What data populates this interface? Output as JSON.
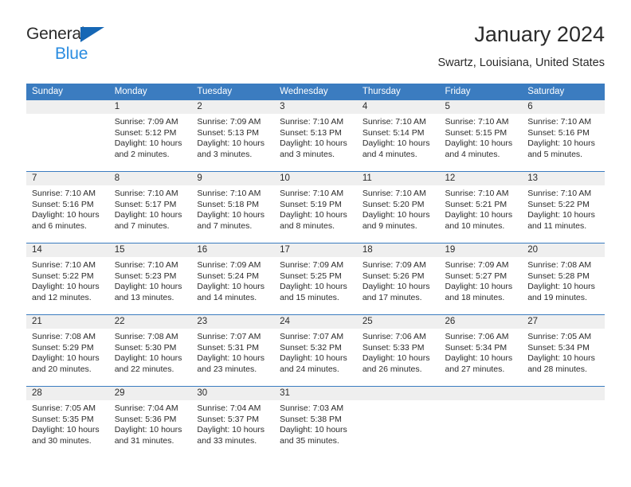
{
  "brand": {
    "name_part1": "General",
    "name_part2": "Blue",
    "accent_color": "#2a8ce0",
    "triangle_color": "#1667b5"
  },
  "header": {
    "title": "January 2024",
    "subtitle": "Swartz, Louisiana, United States"
  },
  "calendar": {
    "header_color": "#3b7cc0",
    "daynum_band_color": "#efefef",
    "weekday_headers": [
      "Sunday",
      "Monday",
      "Tuesday",
      "Wednesday",
      "Thursday",
      "Friday",
      "Saturday"
    ],
    "weeks": [
      [
        {
          "day": "",
          "empty": true,
          "sunrise": "",
          "sunset": "",
          "daylight_line1": "",
          "daylight_line2": ""
        },
        {
          "day": "1",
          "empty": false,
          "sunrise": "Sunrise: 7:09 AM",
          "sunset": "Sunset: 5:12 PM",
          "daylight_line1": "Daylight: 10 hours",
          "daylight_line2": "and 2 minutes."
        },
        {
          "day": "2",
          "empty": false,
          "sunrise": "Sunrise: 7:09 AM",
          "sunset": "Sunset: 5:13 PM",
          "daylight_line1": "Daylight: 10 hours",
          "daylight_line2": "and 3 minutes."
        },
        {
          "day": "3",
          "empty": false,
          "sunrise": "Sunrise: 7:10 AM",
          "sunset": "Sunset: 5:13 PM",
          "daylight_line1": "Daylight: 10 hours",
          "daylight_line2": "and 3 minutes."
        },
        {
          "day": "4",
          "empty": false,
          "sunrise": "Sunrise: 7:10 AM",
          "sunset": "Sunset: 5:14 PM",
          "daylight_line1": "Daylight: 10 hours",
          "daylight_line2": "and 4 minutes."
        },
        {
          "day": "5",
          "empty": false,
          "sunrise": "Sunrise: 7:10 AM",
          "sunset": "Sunset: 5:15 PM",
          "daylight_line1": "Daylight: 10 hours",
          "daylight_line2": "and 4 minutes."
        },
        {
          "day": "6",
          "empty": false,
          "sunrise": "Sunrise: 7:10 AM",
          "sunset": "Sunset: 5:16 PM",
          "daylight_line1": "Daylight: 10 hours",
          "daylight_line2": "and 5 minutes."
        }
      ],
      [
        {
          "day": "7",
          "empty": false,
          "sunrise": "Sunrise: 7:10 AM",
          "sunset": "Sunset: 5:16 PM",
          "daylight_line1": "Daylight: 10 hours",
          "daylight_line2": "and 6 minutes."
        },
        {
          "day": "8",
          "empty": false,
          "sunrise": "Sunrise: 7:10 AM",
          "sunset": "Sunset: 5:17 PM",
          "daylight_line1": "Daylight: 10 hours",
          "daylight_line2": "and 7 minutes."
        },
        {
          "day": "9",
          "empty": false,
          "sunrise": "Sunrise: 7:10 AM",
          "sunset": "Sunset: 5:18 PM",
          "daylight_line1": "Daylight: 10 hours",
          "daylight_line2": "and 7 minutes."
        },
        {
          "day": "10",
          "empty": false,
          "sunrise": "Sunrise: 7:10 AM",
          "sunset": "Sunset: 5:19 PM",
          "daylight_line1": "Daylight: 10 hours",
          "daylight_line2": "and 8 minutes."
        },
        {
          "day": "11",
          "empty": false,
          "sunrise": "Sunrise: 7:10 AM",
          "sunset": "Sunset: 5:20 PM",
          "daylight_line1": "Daylight: 10 hours",
          "daylight_line2": "and 9 minutes."
        },
        {
          "day": "12",
          "empty": false,
          "sunrise": "Sunrise: 7:10 AM",
          "sunset": "Sunset: 5:21 PM",
          "daylight_line1": "Daylight: 10 hours",
          "daylight_line2": "and 10 minutes."
        },
        {
          "day": "13",
          "empty": false,
          "sunrise": "Sunrise: 7:10 AM",
          "sunset": "Sunset: 5:22 PM",
          "daylight_line1": "Daylight: 10 hours",
          "daylight_line2": "and 11 minutes."
        }
      ],
      [
        {
          "day": "14",
          "empty": false,
          "sunrise": "Sunrise: 7:10 AM",
          "sunset": "Sunset: 5:22 PM",
          "daylight_line1": "Daylight: 10 hours",
          "daylight_line2": "and 12 minutes."
        },
        {
          "day": "15",
          "empty": false,
          "sunrise": "Sunrise: 7:10 AM",
          "sunset": "Sunset: 5:23 PM",
          "daylight_line1": "Daylight: 10 hours",
          "daylight_line2": "and 13 minutes."
        },
        {
          "day": "16",
          "empty": false,
          "sunrise": "Sunrise: 7:09 AM",
          "sunset": "Sunset: 5:24 PM",
          "daylight_line1": "Daylight: 10 hours",
          "daylight_line2": "and 14 minutes."
        },
        {
          "day": "17",
          "empty": false,
          "sunrise": "Sunrise: 7:09 AM",
          "sunset": "Sunset: 5:25 PM",
          "daylight_line1": "Daylight: 10 hours",
          "daylight_line2": "and 15 minutes."
        },
        {
          "day": "18",
          "empty": false,
          "sunrise": "Sunrise: 7:09 AM",
          "sunset": "Sunset: 5:26 PM",
          "daylight_line1": "Daylight: 10 hours",
          "daylight_line2": "and 17 minutes."
        },
        {
          "day": "19",
          "empty": false,
          "sunrise": "Sunrise: 7:09 AM",
          "sunset": "Sunset: 5:27 PM",
          "daylight_line1": "Daylight: 10 hours",
          "daylight_line2": "and 18 minutes."
        },
        {
          "day": "20",
          "empty": false,
          "sunrise": "Sunrise: 7:08 AM",
          "sunset": "Sunset: 5:28 PM",
          "daylight_line1": "Daylight: 10 hours",
          "daylight_line2": "and 19 minutes."
        }
      ],
      [
        {
          "day": "21",
          "empty": false,
          "sunrise": "Sunrise: 7:08 AM",
          "sunset": "Sunset: 5:29 PM",
          "daylight_line1": "Daylight: 10 hours",
          "daylight_line2": "and 20 minutes."
        },
        {
          "day": "22",
          "empty": false,
          "sunrise": "Sunrise: 7:08 AM",
          "sunset": "Sunset: 5:30 PM",
          "daylight_line1": "Daylight: 10 hours",
          "daylight_line2": "and 22 minutes."
        },
        {
          "day": "23",
          "empty": false,
          "sunrise": "Sunrise: 7:07 AM",
          "sunset": "Sunset: 5:31 PM",
          "daylight_line1": "Daylight: 10 hours",
          "daylight_line2": "and 23 minutes."
        },
        {
          "day": "24",
          "empty": false,
          "sunrise": "Sunrise: 7:07 AM",
          "sunset": "Sunset: 5:32 PM",
          "daylight_line1": "Daylight: 10 hours",
          "daylight_line2": "and 24 minutes."
        },
        {
          "day": "25",
          "empty": false,
          "sunrise": "Sunrise: 7:06 AM",
          "sunset": "Sunset: 5:33 PM",
          "daylight_line1": "Daylight: 10 hours",
          "daylight_line2": "and 26 minutes."
        },
        {
          "day": "26",
          "empty": false,
          "sunrise": "Sunrise: 7:06 AM",
          "sunset": "Sunset: 5:34 PM",
          "daylight_line1": "Daylight: 10 hours",
          "daylight_line2": "and 27 minutes."
        },
        {
          "day": "27",
          "empty": false,
          "sunrise": "Sunrise: 7:05 AM",
          "sunset": "Sunset: 5:34 PM",
          "daylight_line1": "Daylight: 10 hours",
          "daylight_line2": "and 28 minutes."
        }
      ],
      [
        {
          "day": "28",
          "empty": false,
          "sunrise": "Sunrise: 7:05 AM",
          "sunset": "Sunset: 5:35 PM",
          "daylight_line1": "Daylight: 10 hours",
          "daylight_line2": "and 30 minutes."
        },
        {
          "day": "29",
          "empty": false,
          "sunrise": "Sunrise: 7:04 AM",
          "sunset": "Sunset: 5:36 PM",
          "daylight_line1": "Daylight: 10 hours",
          "daylight_line2": "and 31 minutes."
        },
        {
          "day": "30",
          "empty": false,
          "sunrise": "Sunrise: 7:04 AM",
          "sunset": "Sunset: 5:37 PM",
          "daylight_line1": "Daylight: 10 hours",
          "daylight_line2": "and 33 minutes."
        },
        {
          "day": "31",
          "empty": false,
          "sunrise": "Sunrise: 7:03 AM",
          "sunset": "Sunset: 5:38 PM",
          "daylight_line1": "Daylight: 10 hours",
          "daylight_line2": "and 35 minutes."
        },
        {
          "day": "",
          "empty": true,
          "sunrise": "",
          "sunset": "",
          "daylight_line1": "",
          "daylight_line2": ""
        },
        {
          "day": "",
          "empty": true,
          "sunrise": "",
          "sunset": "",
          "daylight_line1": "",
          "daylight_line2": ""
        },
        {
          "day": "",
          "empty": true,
          "sunrise": "",
          "sunset": "",
          "daylight_line1": "",
          "daylight_line2": ""
        }
      ]
    ]
  }
}
